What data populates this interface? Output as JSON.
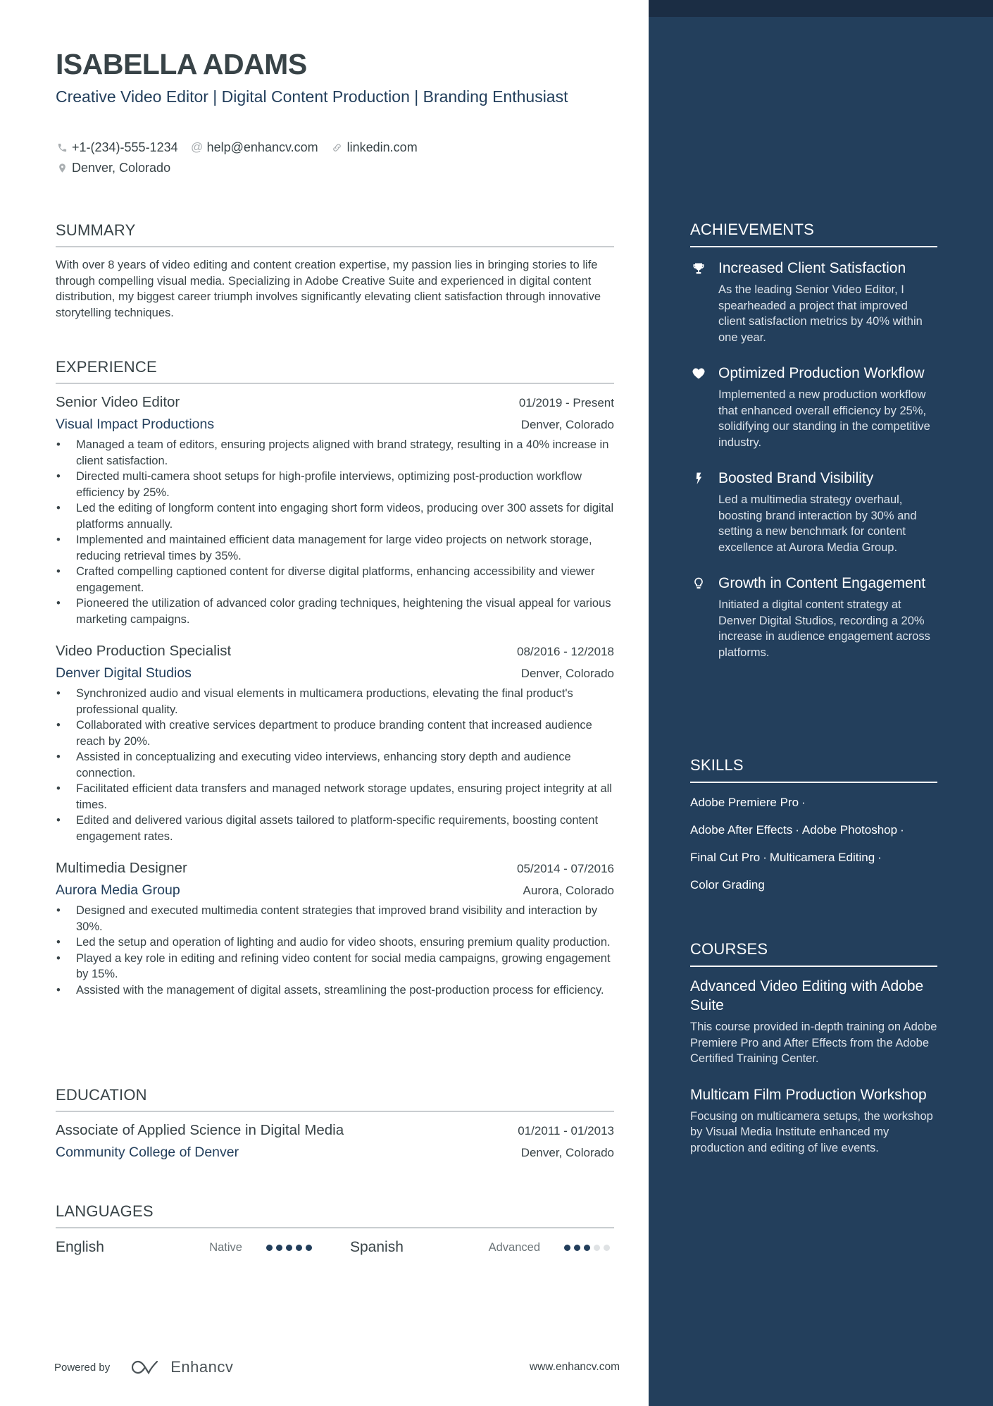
{
  "header": {
    "name": "ISABELLA ADAMS",
    "headline": "Creative Video Editor | Digital Content Production | Branding Enthusiast",
    "contacts": {
      "phone": "+1-(234)-555-1234",
      "email": "help@enhancv.com",
      "link": "linkedin.com",
      "location": "Denver, Colorado"
    }
  },
  "summary": {
    "title": "SUMMARY",
    "text": "With over 8 years of video editing and content creation expertise, my passion lies in bringing stories to life through compelling visual media. Specializing in Adobe Creative Suite and experienced in digital content distribution, my biggest career triumph involves significantly elevating client satisfaction through innovative storytelling techniques."
  },
  "experience": {
    "title": "EXPERIENCE",
    "jobs": [
      {
        "title": "Senior Video Editor",
        "dates": "01/2019 - Present",
        "company": "Visual Impact Productions",
        "location": "Denver, Colorado",
        "bullets": [
          "Managed a team of editors, ensuring projects aligned with brand strategy, resulting in a 40% increase in client satisfaction.",
          "Directed multi-camera shoot setups for high-profile interviews, optimizing post-production workflow efficiency by 25%.",
          "Led the editing of longform content into engaging short form videos, producing over 300 assets for digital platforms annually.",
          "Implemented and maintained efficient data management for large video projects on network storage, reducing retrieval times by 35%.",
          "Crafted compelling captioned content for diverse digital platforms, enhancing accessibility and viewer engagement.",
          "Pioneered the utilization of advanced color grading techniques, heightening the visual appeal for various marketing campaigns."
        ]
      },
      {
        "title": "Video Production Specialist",
        "dates": "08/2016 - 12/2018",
        "company": "Denver Digital Studios",
        "location": "Denver, Colorado",
        "bullets": [
          "Synchronized audio and visual elements in multicamera productions, elevating the final product's professional quality.",
          "Collaborated with creative services department to produce branding content that increased audience reach by 20%.",
          "Assisted in conceptualizing and executing video interviews, enhancing story depth and audience connection.",
          "Facilitated efficient data transfers and managed network storage updates, ensuring project integrity at all times.",
          "Edited and delivered various digital assets tailored to platform-specific requirements, boosting content engagement rates."
        ]
      },
      {
        "title": "Multimedia Designer",
        "dates": "05/2014 - 07/2016",
        "company": "Aurora Media Group",
        "location": "Aurora, Colorado",
        "bullets": [
          "Designed and executed multimedia content strategies that improved brand visibility and interaction by 30%.",
          "Led the setup and operation of lighting and audio for video shoots, ensuring premium quality production.",
          "Played a key role in editing and refining video content for social media campaigns, growing engagement by 15%.",
          "Assisted with the management of digital assets, streamlining the post-production process for efficiency."
        ]
      }
    ]
  },
  "education": {
    "title": "EDUCATION",
    "degree": "Associate of Applied Science in Digital Media",
    "dates": "01/2011 - 01/2013",
    "school": "Community College of Denver",
    "location": "Denver, Colorado"
  },
  "languages": {
    "title": "LANGUAGES",
    "items": [
      {
        "name": "English",
        "level": "Native",
        "rating": 5,
        "max": 5
      },
      {
        "name": "Spanish",
        "level": "Advanced",
        "rating": 3,
        "max": 5
      }
    ]
  },
  "achievements": {
    "title": "ACHIEVEMENTS",
    "items": [
      {
        "icon": "trophy-icon",
        "title": "Increased Client Satisfaction",
        "desc": "As the leading Senior Video Editor, I spearheaded a project that improved client satisfaction metrics by 40% within one year."
      },
      {
        "icon": "heart-icon",
        "title": "Optimized Production Workflow",
        "desc": "Implemented a new production workflow that enhanced overall efficiency by 25%, solidifying our standing in the competitive industry."
      },
      {
        "icon": "lightning-icon",
        "title": "Boosted Brand Visibility",
        "desc": "Led a multimedia strategy overhaul, boosting brand interaction by 30% and setting a new benchmark for content excellence at Aurora Media Group."
      },
      {
        "icon": "lightbulb-icon",
        "title": "Growth in Content Engagement",
        "desc": "Initiated a digital content strategy at Denver Digital Studios, recording a 20% increase in audience engagement across platforms."
      }
    ]
  },
  "skills": {
    "title": "SKILLS",
    "lines": [
      [
        "Adobe Premiere Pro"
      ],
      [
        "Adobe After Effects",
        "Adobe Photoshop"
      ],
      [
        "Final Cut Pro",
        "Multicamera Editing"
      ],
      [
        "Color Grading"
      ]
    ],
    "separator": "·"
  },
  "courses": {
    "title": "COURSES",
    "items": [
      {
        "title": "Advanced Video Editing with Adobe Suite",
        "desc": "This course provided in-depth training on Adobe Premiere Pro and After Effects from the Adobe Certified Training Center."
      },
      {
        "title": "Multicam Film Production Workshop",
        "desc": "Focusing on multicamera setups, the workshop by Visual Media Institute enhanced my production and editing of live events."
      }
    ]
  },
  "footer": {
    "powered_by": "Powered by",
    "brand": "Enhancv",
    "website": "www.enhancv.com"
  },
  "colors": {
    "accent": "#233f5c",
    "sidebar": "#233f5c",
    "sidebar_top": "#1b2d44",
    "text": "#384347",
    "dot_off": "#dfe2e4"
  }
}
